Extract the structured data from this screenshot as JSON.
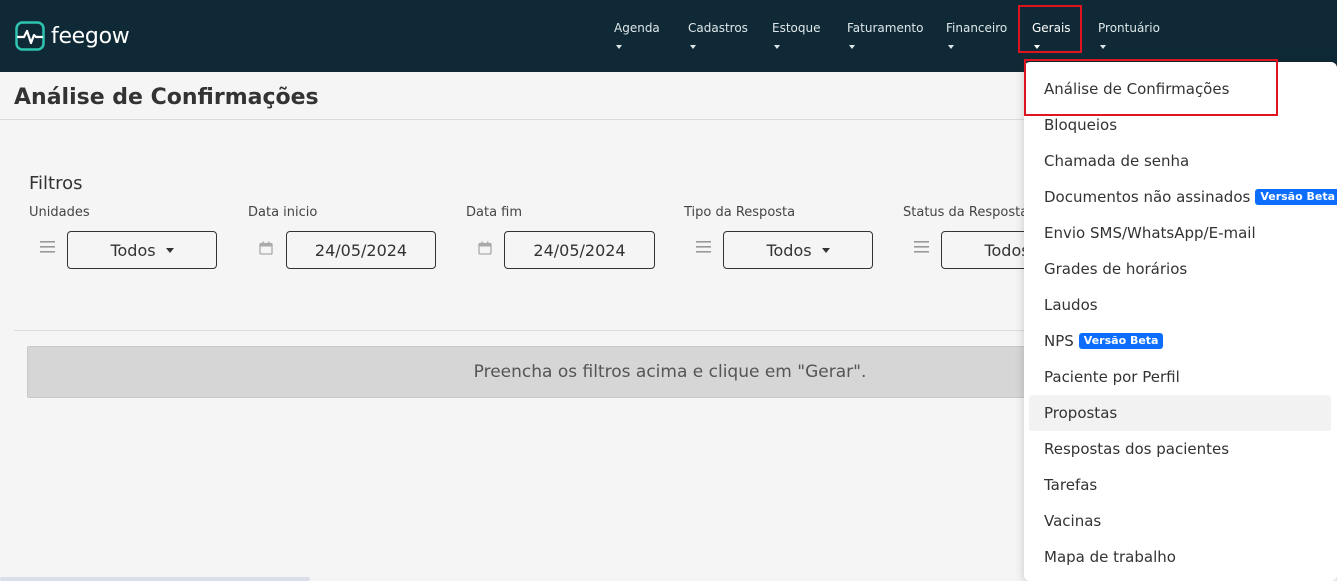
{
  "app": {
    "brand": "feegow"
  },
  "nav": {
    "items": [
      {
        "label": "Agenda"
      },
      {
        "label": "Cadastros"
      },
      {
        "label": "Estoque"
      },
      {
        "label": "Faturamento"
      },
      {
        "label": "Financeiro"
      },
      {
        "label": "Gerais",
        "active": true
      },
      {
        "label": "Prontuário"
      }
    ]
  },
  "page": {
    "title": "Análise de Confirmações"
  },
  "filters": {
    "title": "Filtros",
    "unidades": {
      "label": "Unidades",
      "value": "Todos"
    },
    "data_inicio": {
      "label": "Data inicio",
      "value": "24/05/2024"
    },
    "data_fim": {
      "label": "Data fim",
      "value": "24/05/2024"
    },
    "tipo_resposta": {
      "label": "Tipo da Resposta",
      "value": "Todos"
    },
    "status_resposta": {
      "label": "Status da Resposta",
      "value": "Todos"
    }
  },
  "alert": {
    "message": "Preencha os filtros acima e clique em \"Gerar\"."
  },
  "dropdown": {
    "items": [
      {
        "label": "Análise de Confirmações"
      },
      {
        "label": "Bloqueios"
      },
      {
        "label": "Chamada de senha"
      },
      {
        "label": "Documentos não assinados",
        "badge": "Versão Beta"
      },
      {
        "label": "Envio SMS/WhatsApp/E-mail"
      },
      {
        "label": "Grades de horários"
      },
      {
        "label": "Laudos"
      },
      {
        "label": "NPS",
        "badge": "Versão Beta"
      },
      {
        "label": "Paciente por Perfil"
      },
      {
        "label": "Propostas",
        "hovered": true
      },
      {
        "label": "Respostas dos pacientes"
      },
      {
        "label": "Tarefas"
      },
      {
        "label": "Vacinas"
      },
      {
        "label": "Mapa de trabalho"
      }
    ]
  },
  "colors": {
    "topbar": "#0f2a36",
    "logo_accent": "#2fc4b2",
    "highlight": "#e0141e",
    "beta_badge": "#0d6efd"
  }
}
